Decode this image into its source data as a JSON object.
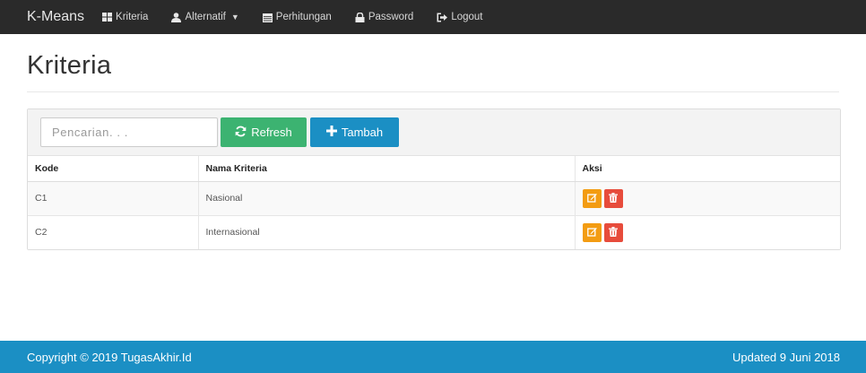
{
  "navbar": {
    "brand": "K-Means",
    "items": [
      {
        "label": "Kriteria",
        "icon": "grid-icon"
      },
      {
        "label": "Alternatif",
        "icon": "user-icon",
        "dropdown": true
      },
      {
        "label": "Perhitungan",
        "icon": "calendar-icon"
      },
      {
        "label": "Password",
        "icon": "lock-icon"
      },
      {
        "label": "Logout",
        "icon": "logout-icon"
      }
    ]
  },
  "page": {
    "title": "Kriteria"
  },
  "toolbar": {
    "search_placeholder": "Pencarian. . .",
    "refresh_label": "Refresh",
    "add_label": "Tambah"
  },
  "table": {
    "columns": [
      "Kode",
      "Nama Kriteria",
      "Aksi"
    ],
    "rows": [
      {
        "kode": "C1",
        "nama": "Nasional"
      },
      {
        "kode": "C2",
        "nama": "Internasional"
      }
    ]
  },
  "footer": {
    "copyright": "Copyright © 2019 TugasAkhir.Id",
    "updated": "Updated 9 Juni 2018"
  },
  "colors": {
    "navbar_bg": "#2a2a2a",
    "refresh_btn": "#3cb371",
    "add_btn": "#1b8fc4",
    "edit_btn": "#f39c12",
    "delete_btn": "#e74c3c",
    "footer_bg": "#1b8fc4"
  }
}
